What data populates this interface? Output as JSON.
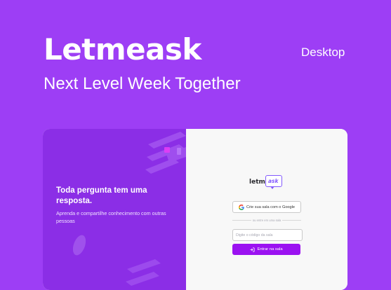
{
  "hero": {
    "title": "Letmeask",
    "subtitle": "Next Level Week Together",
    "platform": "Desktop"
  },
  "aside": {
    "title": "Toda pergunta tem uma resposta.",
    "text": "Aprenda e compartilhe conhecimento com outras pessoas"
  },
  "auth": {
    "logo_text": "letme",
    "logo_bubble": "ask",
    "google_button": "Crie sua sala com o Google",
    "separator": "ou entre em uma sala",
    "room_placeholder": "Digite o código da sala",
    "enter_button": "Entrar na sala"
  },
  "colors": {
    "background": "#9d3ef5",
    "aside": "#8b2ee6",
    "brand_purple": "#835afd",
    "primary_button": "#9b12f1"
  },
  "icons": [
    "google-icon",
    "log-in-icon",
    "chat-bubble-icon"
  ]
}
